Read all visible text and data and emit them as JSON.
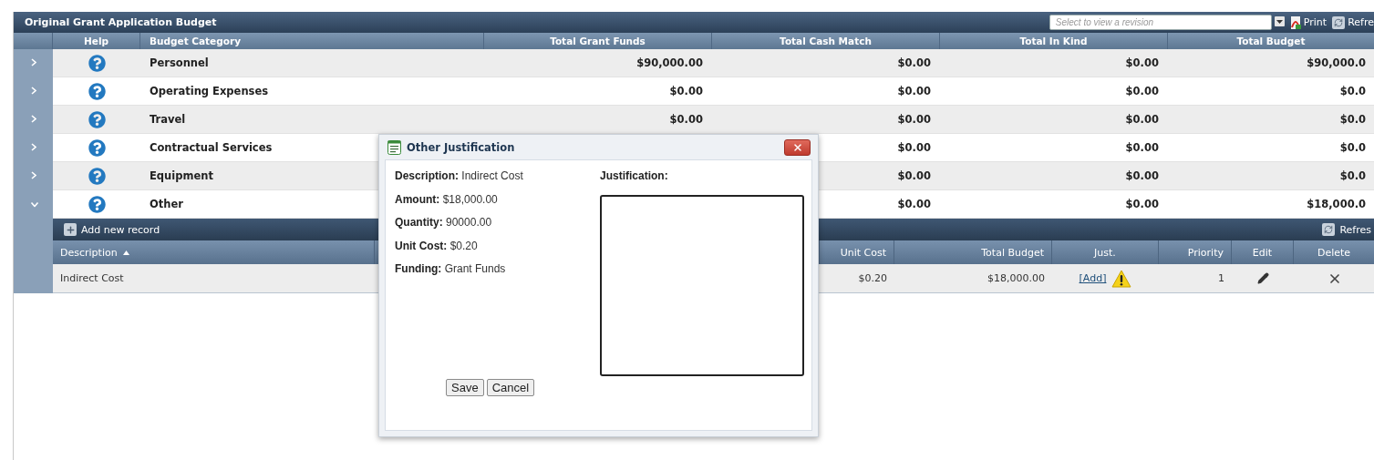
{
  "grid": {
    "title": "Original Grant Application Budget",
    "revision_select": {
      "placeholder": "Select to view a revision"
    },
    "toolbar": [
      {
        "label": "Print",
        "kind": "print"
      },
      {
        "label": "Refre",
        "kind": "refresh"
      }
    ],
    "columns": [
      "Help",
      "Budget Category",
      "Total Grant Funds",
      "Total Cash Match",
      "Total In Kind",
      "Total Budget"
    ],
    "rows": [
      {
        "category": "Personnel",
        "grant": "$90,000.00",
        "cash": "$0.00",
        "in_kind": "$0.00",
        "total": "$90,000.0",
        "expanded": false
      },
      {
        "category": "Operating Expenses",
        "grant": "$0.00",
        "cash": "$0.00",
        "in_kind": "$0.00",
        "total": "$0.0",
        "expanded": false
      },
      {
        "category": "Travel",
        "grant": "$0.00",
        "cash": "$0.00",
        "in_kind": "$0.00",
        "total": "$0.0",
        "expanded": false
      },
      {
        "category": "Contractual Services",
        "cash": "$0.00",
        "in_kind": "$0.00",
        "total": "$0.0",
        "expanded": false
      },
      {
        "category": "Equipment",
        "cash": "$0.00",
        "in_kind": "$0.00",
        "total": "$0.0",
        "expanded": false
      },
      {
        "category": "Other",
        "cash": "$0.00",
        "in_kind": "$0.00",
        "total": "$18,000.0",
        "expanded": true
      }
    ],
    "detail": {
      "add_label": "Add new record",
      "refresh_label": "Refres",
      "columns": [
        {
          "label": "Description",
          "sort_ascending": true
        },
        {
          "label": "Unit Cost"
        },
        {
          "label": "Total Budget"
        },
        {
          "label": "Just."
        },
        {
          "label": "Priority"
        },
        {
          "label": "Edit"
        },
        {
          "label": "Delete"
        }
      ],
      "rows": [
        {
          "description": "Indirect Cost",
          "unit_cost": "$0.20",
          "total_budget": "$18,000.00",
          "just_link": "[Add]",
          "warning": true,
          "priority": "1"
        }
      ]
    }
  },
  "dialog": {
    "title": "Other Justification",
    "fields": [
      {
        "label": "Description:",
        "value": "Indirect Cost"
      },
      {
        "label": "Amount:",
        "value": "$18,000.00"
      },
      {
        "label": "Quantity:",
        "value": "90000.00"
      },
      {
        "label": "Unit Cost:",
        "value": "$0.20"
      },
      {
        "label": "Funding:",
        "value": "Grant Funds"
      }
    ],
    "justification_label": "Justification:",
    "buttons": [
      "Save",
      "Cancel"
    ]
  }
}
